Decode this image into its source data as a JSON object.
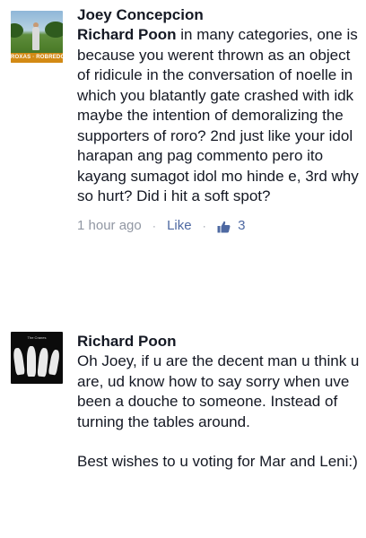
{
  "comments": [
    {
      "author": "Joey Concepcion",
      "avatar_badge": "ROXAS · ROBREDO",
      "mention": "Richard Poon",
      "text": " in many categories, one is because you werent thrown as an object of ridicule in the conversation of noelle in which you blatantly gate crashed with idk maybe the intention of demoralizing the supporters of roro? 2nd just like your idol harapan ang pag commento pero ito kayang sumagot idol mo hinde e, 3rd why so hurt? Did i hit a soft spot?",
      "timestamp": "1 hour ago",
      "like_label": "Like",
      "separator": "·",
      "like_icon": "thumbs-up-icon",
      "like_count": "3"
    },
    {
      "author": "Richard Poon",
      "avatar_caption": "The Cranes",
      "paragraph1": "Oh Joey, if u are the decent man u think u are, ud know how to say sorry when uve been a douche to someone. Instead of turning the tables around.",
      "paragraph2": "Best wishes to u voting for Mar and Leni:)"
    }
  ],
  "colors": {
    "text": "#141823",
    "meta": "#9197a3",
    "link": "#4e69a2"
  }
}
